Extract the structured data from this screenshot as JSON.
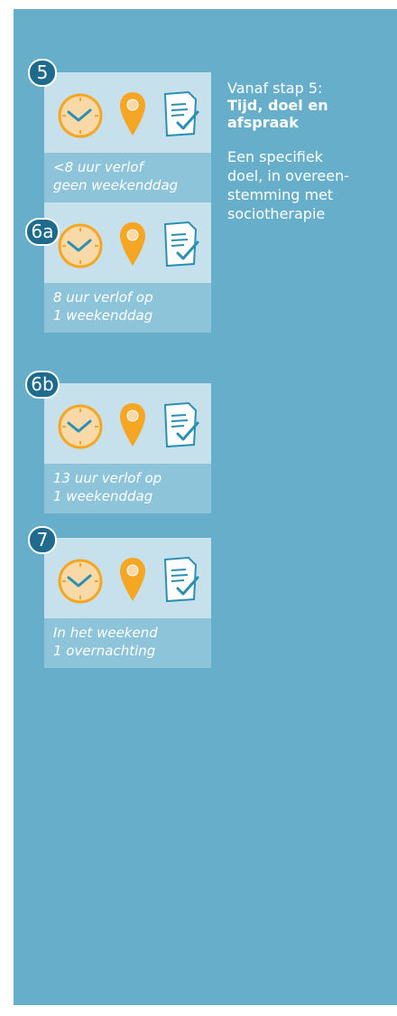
{
  "colors": {
    "panel": "#67aecb",
    "card_light": "#c7e1ec",
    "card_mid": "#8ec4da",
    "badge": "#1e6b8d",
    "clock_face": "#f8d9a7",
    "clock_ring": "#f5a623",
    "pin": "#f5a623",
    "doc_check": "#2a8fb3"
  },
  "icons": [
    "clock-icon",
    "location-pin-icon",
    "checklist-document-icon"
  ],
  "steps": [
    {
      "label": "5",
      "text_lines": [
        "<8 uur verlof",
        "geen weekenddag"
      ]
    },
    {
      "label": "6a",
      "text_lines": [
        "8 uur verlof op",
        "1 weekenddag"
      ]
    },
    {
      "label": "6b",
      "text_lines": [
        "13 uur verlof op",
        "1 weekenddag"
      ]
    },
    {
      "label": "7",
      "text_lines": [
        "In het weekend",
        "1 overnachting"
      ]
    }
  ],
  "side": {
    "intro": "Vanaf stap 5:",
    "heading_lines": [
      "Tijd, doel en",
      "afspraak"
    ],
    "body_lines": [
      "Een specifiek",
      "doel, in overeen-",
      "stemming met",
      "sociotherapie"
    ]
  }
}
